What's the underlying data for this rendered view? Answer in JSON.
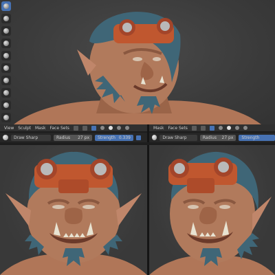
{
  "colors": {
    "skin": "#b07658",
    "hair": "#3f6677",
    "goggles": "#c0572f",
    "lens": "#b9b9b9",
    "accent": "#4772b3",
    "header": "#303030"
  },
  "toolbar": {
    "icons": [
      "draw-sharp-brush-icon",
      "draw-brush-icon",
      "clay-brush-icon",
      "clay-strips-icon",
      "layer-brush-icon",
      "inflate-brush-icon",
      "blob-brush-icon",
      "crease-brush-icon",
      "smooth-brush-icon",
      "flatten-brush-icon",
      "fill-brush-icon",
      "scrape-brush-icon",
      "pinch-brush-icon",
      "grab-brush-icon",
      "snake-hook-brush-icon",
      "mask-brush-icon",
      "box-mask-icon"
    ]
  },
  "header_left": {
    "menus": [
      "View",
      "Sculpt",
      "Mask",
      "Face Sets"
    ]
  },
  "header_right": {
    "menus": [
      "Mask",
      "Face Sets"
    ]
  },
  "tool_settings_left": {
    "brush": "Draw Sharp",
    "radius_label": "Radius",
    "radius_value": "27 px",
    "strength_label": "Strength",
    "strength_value": "0.339"
  },
  "tool_settings_right": {
    "brush": "Draw Sharp",
    "radius_label": "Radius",
    "radius_value": "27 px",
    "strength_label": "Strength"
  }
}
